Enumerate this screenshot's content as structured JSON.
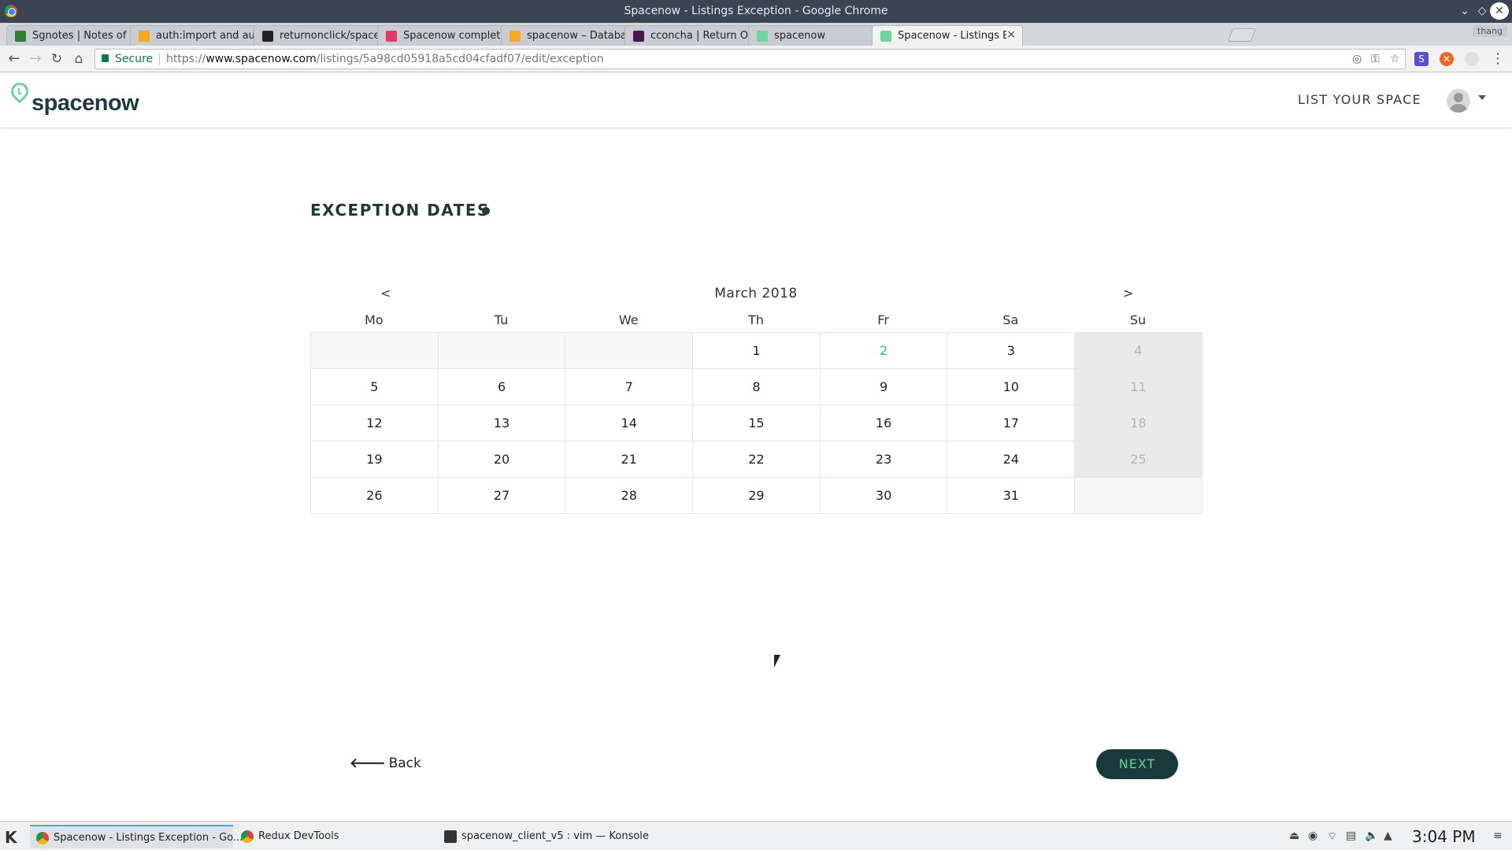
{
  "window": {
    "title": "Spacenow - Listings Exception - Google Chrome"
  },
  "tabs": [
    {
      "label": "Sgnotes | Notes of Ev",
      "icon": "sgnotes-icon",
      "color": "#2e7d32"
    },
    {
      "label": "auth:import and auth",
      "icon": "firebase-icon",
      "color": "#f6a821"
    },
    {
      "label": "returnonclick/spacen",
      "icon": "github-icon",
      "color": "#222222"
    },
    {
      "label": "Spacenow completed",
      "icon": "invision-icon",
      "color": "#e23a64"
    },
    {
      "label": "spacenow – Database",
      "icon": "firebase-icon",
      "color": "#f6a821"
    },
    {
      "label": "cconcha | Return On C",
      "icon": "slack-icon",
      "color": "#4a154b"
    },
    {
      "label": "spacenow",
      "icon": "spacenow-icon",
      "color": "#6fd39b"
    },
    {
      "label": "Spacenow - Listings Ex",
      "icon": "spacenow-icon",
      "color": "#6fd39b",
      "active": true
    }
  ],
  "profile_chip": "thang",
  "toolbar": {
    "secure_label": "Secure",
    "url_scheme": "https://",
    "url_host": "www.spacenow.com",
    "url_path": "/listings/5a98cd05918a5cd04cfadf07/edit/exception"
  },
  "header": {
    "logo_text": "spacenow",
    "list_your_space": "LIST YOUR SPACE"
  },
  "main": {
    "section_title": "EXCEPTION DATES",
    "back_label": "Back",
    "next_label": "NEXT"
  },
  "calendar": {
    "prev": "<",
    "next": ">",
    "caption": "March 2018",
    "weekdays": [
      "Mo",
      "Tu",
      "We",
      "Th",
      "Fr",
      "Sa",
      "Su"
    ],
    "cells": [
      {
        "label": "",
        "state": "empty"
      },
      {
        "label": "",
        "state": "empty"
      },
      {
        "label": "",
        "state": "empty"
      },
      {
        "label": "1",
        "state": "normal"
      },
      {
        "label": "2",
        "state": "today"
      },
      {
        "label": "3",
        "state": "normal"
      },
      {
        "label": "4",
        "state": "disabled"
      },
      {
        "label": "5",
        "state": "normal"
      },
      {
        "label": "6",
        "state": "normal"
      },
      {
        "label": "7",
        "state": "normal"
      },
      {
        "label": "8",
        "state": "normal"
      },
      {
        "label": "9",
        "state": "normal"
      },
      {
        "label": "10",
        "state": "normal"
      },
      {
        "label": "11",
        "state": "disabled"
      },
      {
        "label": "12",
        "state": "normal"
      },
      {
        "label": "13",
        "state": "normal"
      },
      {
        "label": "14",
        "state": "normal"
      },
      {
        "label": "15",
        "state": "normal"
      },
      {
        "label": "16",
        "state": "normal"
      },
      {
        "label": "17",
        "state": "normal"
      },
      {
        "label": "18",
        "state": "disabled"
      },
      {
        "label": "19",
        "state": "normal"
      },
      {
        "label": "20",
        "state": "normal"
      },
      {
        "label": "21",
        "state": "normal"
      },
      {
        "label": "22",
        "state": "normal"
      },
      {
        "label": "23",
        "state": "normal"
      },
      {
        "label": "24",
        "state": "normal"
      },
      {
        "label": "25",
        "state": "disabled"
      },
      {
        "label": "26",
        "state": "normal"
      },
      {
        "label": "27",
        "state": "normal"
      },
      {
        "label": "28",
        "state": "normal"
      },
      {
        "label": "29",
        "state": "normal"
      },
      {
        "label": "30",
        "state": "normal"
      },
      {
        "label": "31",
        "state": "normal"
      },
      {
        "label": "",
        "state": "empty"
      }
    ]
  },
  "taskbar": {
    "tasks": [
      {
        "label": "Spacenow - Listings Exception - Go...",
        "icon": "chrome-icon",
        "active": true
      },
      {
        "label": "Redux DevTools",
        "icon": "chrome-icon",
        "active": false
      },
      {
        "label": "spacenow_client_v5 : vim — Konsole",
        "icon": "terminal-icon",
        "active": false
      }
    ],
    "clock": "3:04 PM"
  },
  "colors": {
    "brand_dark": "#19393b",
    "brand_green": "#5fd296",
    "today_blue": "#2aa6c9"
  }
}
